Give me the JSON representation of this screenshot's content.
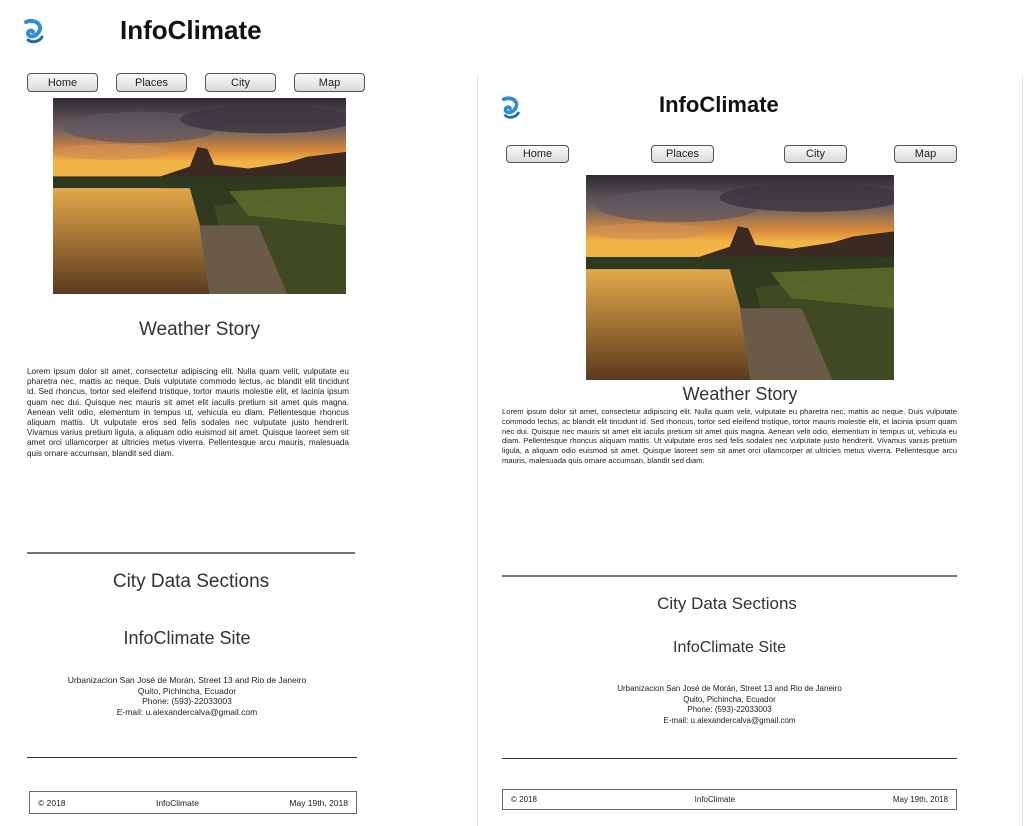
{
  "site": {
    "title": "InfoClimate"
  },
  "nav": {
    "home": "Home",
    "places": "Places",
    "city": "City",
    "map": "Map"
  },
  "story": {
    "heading": "Weather Story",
    "body": "Lorem ipsum dolor sit amet, consectetur adipiscing elit. Nulla quam velit, vulputate eu pharetra nec, mattis ac neque. Duis vulputate commodo lectus, ac blandit elit tincidunt id. Sed rhoncus, tortor sed eleifend tristique, tortor mauris molestie elit, et lacinia ipsum quam nec dui. Quisque nec mauris sit amet elit iaculis pretium sit amet quis magna. Aenean velit odio, elementum in tempus ut, vehicula eu diam. Pellentesque rhoncus aliquam mattis. Ut vulputate eros sed felis sodales nec vulputate justo hendrerit. Vivamus varius pretium ligula, a aliquam odio euismod sit amet. Quisque laoreet sem sit amet orci ullamcorper at ultricies metus viverra. Pellentesque arcu mauris, malesuada quis ornare accumsan, blandit sed diam."
  },
  "city_data": {
    "heading": "City Data Sections"
  },
  "site_info": {
    "heading": "InfoClimate Site",
    "address": "Urbanizacion San José de Morán, Street 13 and Rio de Janeiro",
    "city": "Quito, Pichincha, Ecuador",
    "phone": "Phone: (593)-22033003",
    "email": "E-mail: u.alexandercalva@gmail.com"
  },
  "footer": {
    "copyright": "© 2018",
    "brand": "InfoClimate",
    "date": "May 19th, 2018"
  },
  "colors": {
    "logo_blue": "#2f8fd4",
    "divider": "#777777"
  },
  "icons": {
    "logo": "swirl-logo-icon",
    "hero": "landscape-photo"
  }
}
